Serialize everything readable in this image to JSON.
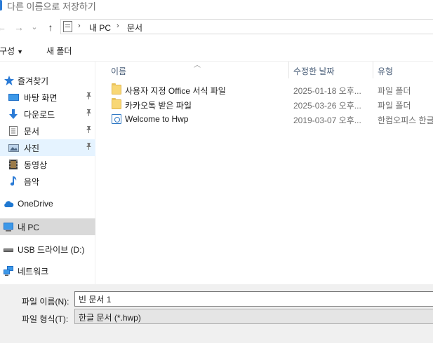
{
  "window": {
    "title": "다른 이름으로 저장하기"
  },
  "nav": {
    "back_glyph": "←",
    "forward_glyph": "→",
    "recent_glyph": "⌄",
    "up_glyph": "↑",
    "breadcrumb": [
      "내 PC",
      "문서"
    ],
    "separator": "›"
  },
  "commands": {
    "organize": "구성",
    "new_folder": "새 폴더"
  },
  "sidebar": {
    "items": [
      {
        "label": "즐겨찾기",
        "icon": "star-icon",
        "pinned": false
      },
      {
        "label": "바탕 화면",
        "icon": "desktop-icon",
        "pinned": true
      },
      {
        "label": "다운로드",
        "icon": "download-icon",
        "pinned": true
      },
      {
        "label": "문서",
        "icon": "document-icon",
        "pinned": true
      },
      {
        "label": "사진",
        "icon": "pictures-icon",
        "pinned": true
      },
      {
        "label": "동영상",
        "icon": "video-icon",
        "pinned": false
      },
      {
        "label": "음악",
        "icon": "music-icon",
        "pinned": false
      },
      {
        "label": "OneDrive",
        "icon": "cloud-icon",
        "pinned": false
      },
      {
        "label": "내 PC",
        "icon": "computer-icon",
        "pinned": false
      },
      {
        "label": "USB 드라이브 (D:)",
        "icon": "usb-drive-icon",
        "pinned": false
      },
      {
        "label": "네트워크",
        "icon": "network-icon",
        "pinned": false
      }
    ],
    "pin_glyph": "📌"
  },
  "filelist": {
    "columns": {
      "name": "이름",
      "date": "수정한 날짜",
      "type": "유형"
    },
    "rows": [
      {
        "name": "사용자 지정 Office 서식 파일",
        "date": "2025-01-18 오후...",
        "type": "파일 폴더",
        "icon": "folder-icon"
      },
      {
        "name": "카카오톡 받은 파일",
        "date": "2025-03-26 오후...",
        "type": "파일 폴더",
        "icon": "folder-icon"
      },
      {
        "name": "Welcome to Hwp",
        "date": "2019-03-07 오후...",
        "type": "한컴오피스 한글",
        "icon": "hwp-file-icon"
      }
    ]
  },
  "form": {
    "filename_label": "파일 이름(N):",
    "filename_value": "빈 문서 1",
    "filetype_label": "파일 형식(T):",
    "filetype_value": "한글 문서 (*.hwp)"
  },
  "colors": {
    "accent": "#2b7bd6",
    "selected_bg": "#e5f3ff",
    "current_bg": "#d9d9d9",
    "folder": "#f8d775"
  }
}
